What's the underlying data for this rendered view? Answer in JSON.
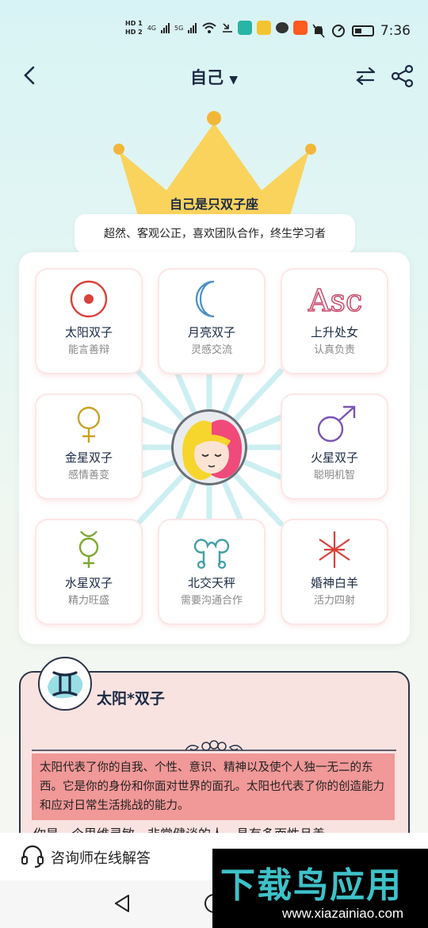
{
  "status_bar": {
    "hd1": "HD 1",
    "hd2": "HD 2",
    "net1": "4G",
    "net2": "5G",
    "time": "7:36"
  },
  "header": {
    "title": "自己"
  },
  "crown": {
    "title": "自己是只双子座",
    "tagline": "超然、客观公正，喜欢团队合作，终生学习者"
  },
  "planets": [
    {
      "name": "太阳双子",
      "desc": "能言善辩",
      "icon": "sun-icon",
      "color": "#d9413a"
    },
    {
      "name": "月亮双子",
      "desc": "灵感交流",
      "icon": "moon-icon",
      "color": "#4a8fc7"
    },
    {
      "name": "上升处女",
      "desc": "认真负责",
      "icon": "asc-icon",
      "color": "#c94a6b"
    },
    {
      "name": "金星双子",
      "desc": "感情善变",
      "icon": "venus-icon",
      "color": "#c9a227"
    },
    {
      "name": "火星双子",
      "desc": "聪明机智",
      "icon": "mars-icon",
      "color": "#7a55b3"
    },
    {
      "name": "水星双子",
      "desc": "精力旺盛",
      "icon": "mercury-icon",
      "color": "#7da834"
    },
    {
      "name": "北交天秤",
      "desc": "需要沟通合作",
      "icon": "north-node-icon",
      "color": "#3f9fa8"
    },
    {
      "name": "婚神白羊",
      "desc": "活力四射",
      "icon": "juno-icon",
      "color": "#d9413a"
    }
  ],
  "detail": {
    "title": "太阳*双子",
    "text": "太阳代表了你的自我、个性、意识、精神以及使个人独一无二的东西。它是你的身份和你面对世界的面孔。太阳也代表了你的创造能力和应对日常生活挑战的能力。",
    "more": "你是一个思维灵敏、非常健谈的人，具有多面性且善"
  },
  "consult": {
    "label": "咨询师在线解答"
  },
  "watermark": {
    "brand": "下载鸟应用",
    "url": "www.xiazainiao.com"
  },
  "colors": {
    "accent": "#1c2b44",
    "crown": "#f9d35c",
    "detail_bg": "#f9e3e1",
    "highlight": "#f19898"
  }
}
